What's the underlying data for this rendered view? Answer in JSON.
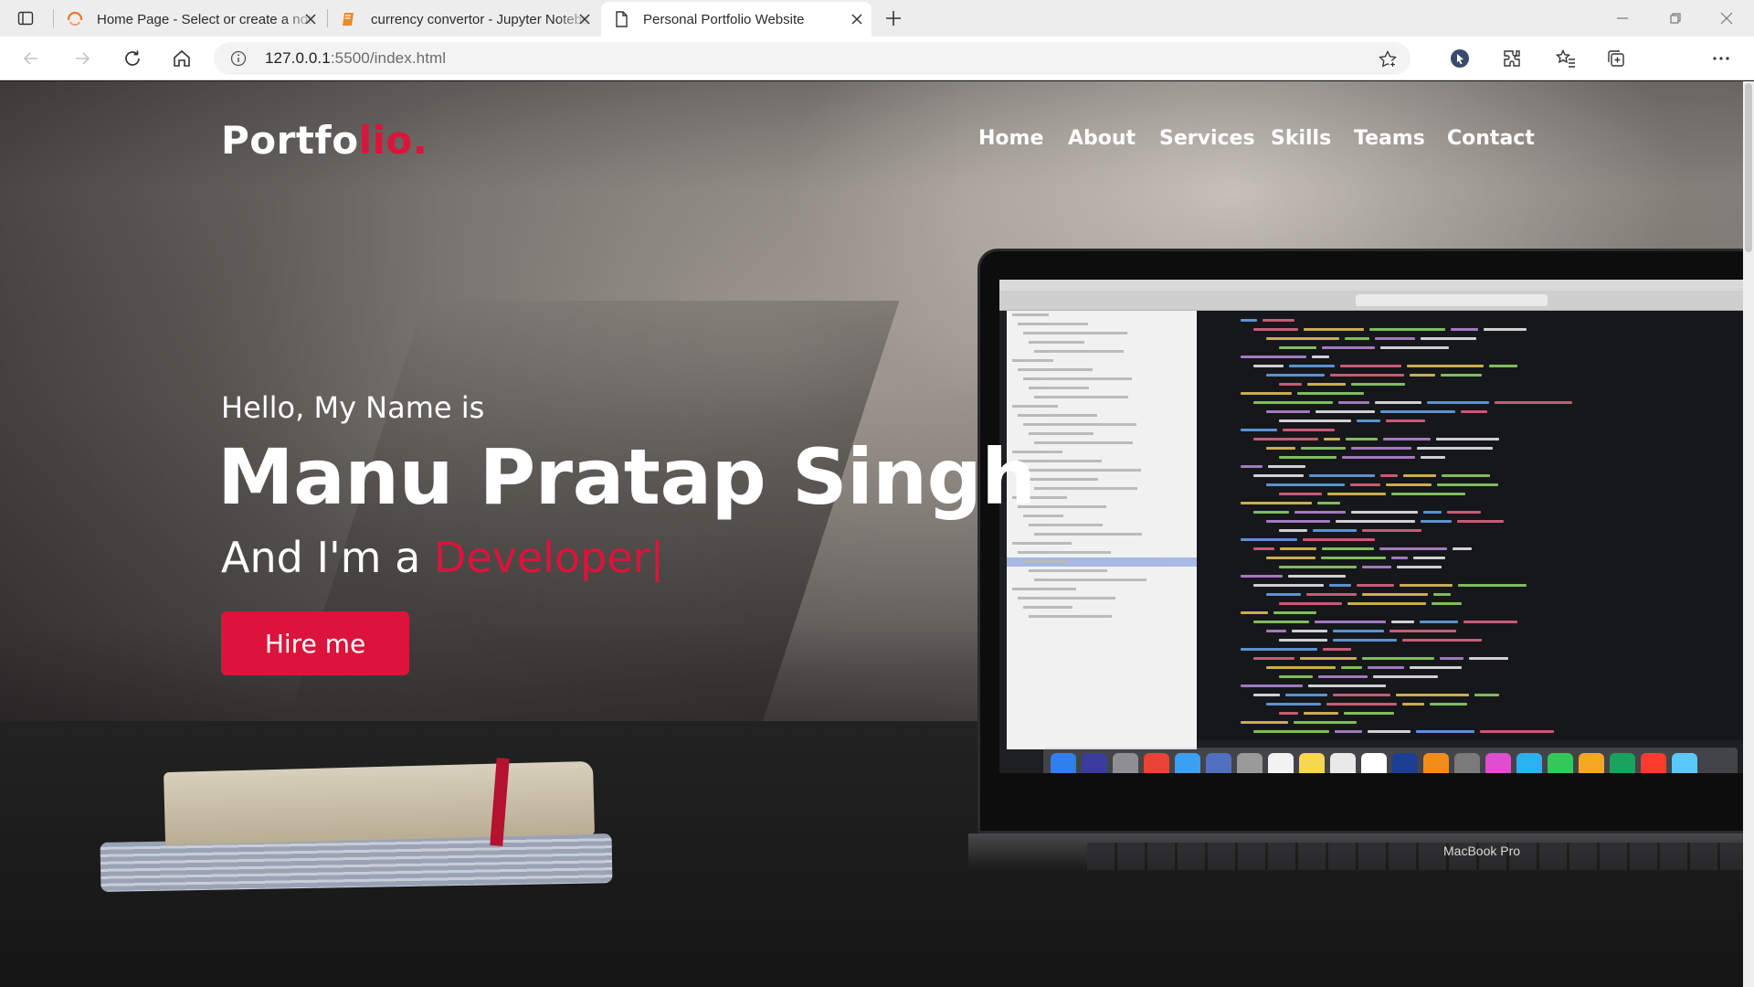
{
  "browser": {
    "tabs": [
      {
        "title": "Home Page - Select or create a notebook",
        "icon": "jupyter-loading-icon",
        "active": false
      },
      {
        "title": "currency convertor - Jupyter Notebook",
        "icon": "notebook-icon",
        "active": false
      },
      {
        "title": "Personal Portfolio Website",
        "icon": "page-icon",
        "active": true
      }
    ],
    "url_host": "127.0.0.1",
    "url_rest": ":5500/index.html"
  },
  "page": {
    "brand": {
      "text": "Portfo",
      "accent": "lio."
    },
    "nav": [
      "Home",
      "About",
      "Services",
      "Skills",
      "Teams",
      "Contact"
    ],
    "hero": {
      "greeting": "Hello, My Name is",
      "name": "Manu Pratap Singh",
      "role_prefix": "And I'm a ",
      "role_typed": "Developer",
      "cursor": "|",
      "cta": "Hire me"
    },
    "laptop_label": "MacBook Pro",
    "accent_color": "#dc143c"
  }
}
